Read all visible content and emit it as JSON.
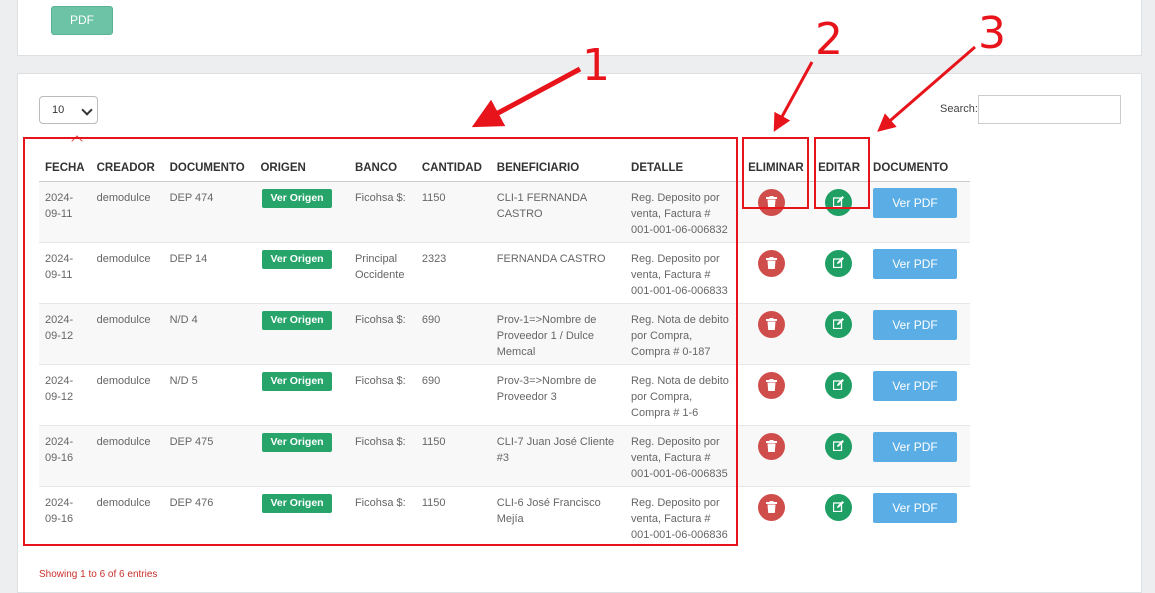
{
  "top_panel": {
    "pdf_label": "PDF"
  },
  "table_controls": {
    "page_length": "10",
    "search_label": "Search:",
    "search_value": ""
  },
  "columns": [
    "FECHA",
    "CREADOR",
    "DOCUMENTO",
    "ORIGEN",
    "BANCO",
    "CANTIDAD",
    "BENEFICIARIO",
    "DETALLE",
    "ELIMINAR",
    "EDITAR",
    "DOCUMENTO"
  ],
  "action_labels": {
    "ver_origen": "Ver Origen",
    "ver_pdf": "Ver PDF"
  },
  "rows": [
    {
      "fecha": [
        "2024-",
        "09-11"
      ],
      "creador": "demodulce",
      "documento": "DEP 474",
      "banco": [
        "Ficohsa $:"
      ],
      "cantidad": "1150",
      "beneficiario": [
        "CLI-1   FERNANDA",
        "CASTRO"
      ],
      "detalle": [
        "Reg. Deposito por",
        "venta, Factura #",
        "001-001-06-006832"
      ]
    },
    {
      "fecha": [
        "2024-",
        "09-11"
      ],
      "creador": "demodulce",
      "documento": "DEP 14",
      "banco": [
        "Principal",
        "Occidente"
      ],
      "cantidad": "2323",
      "beneficiario": [
        "FERNANDA CASTRO"
      ],
      "detalle": [
        "Reg. Deposito por",
        "venta, Factura #",
        "001-001-06-006833"
      ]
    },
    {
      "fecha": [
        "2024-",
        "09-12"
      ],
      "creador": "demodulce",
      "documento": "N/D 4",
      "banco": [
        "Ficohsa $:"
      ],
      "cantidad": "690",
      "beneficiario": [
        "Prov-1=>Nombre de",
        "Proveedor 1 / Dulce",
        "Memcal"
      ],
      "detalle": [
        "Reg. Nota de debito",
        "por Compra,",
        "Compra # 0-187"
      ]
    },
    {
      "fecha": [
        "2024-",
        "09-12"
      ],
      "creador": "demodulce",
      "documento": "N/D 5",
      "banco": [
        "Ficohsa $:"
      ],
      "cantidad": "690",
      "beneficiario": [
        "Prov-3=>Nombre de",
        "Proveedor 3"
      ],
      "detalle": [
        "Reg. Nota de debito",
        "por Compra,",
        "Compra # 1-6"
      ]
    },
    {
      "fecha": [
        "2024-",
        "09-16"
      ],
      "creador": "demodulce",
      "documento": "DEP 475",
      "banco": [
        "Ficohsa $:"
      ],
      "cantidad": "1150",
      "beneficiario": [
        "CLI-7   Juan José Cliente",
        "#3"
      ],
      "detalle": [
        "Reg. Deposito por",
        "venta, Factura #",
        "001-001-06-006835"
      ]
    },
    {
      "fecha": [
        "2024-",
        "09-16"
      ],
      "creador": "demodulce",
      "documento": "DEP 476",
      "banco": [
        "Ficohsa $:"
      ],
      "cantidad": "1150",
      "beneficiario": [
        "CLI-6   José Francisco",
        "Mejía"
      ],
      "detalle": [
        "Reg. Deposito por",
        "venta, Factura #",
        "001-001-06-006836"
      ]
    }
  ],
  "footer": {
    "info": "Showing 1 to 6 of 6 entries"
  },
  "annotations": [
    "1",
    "2",
    "3"
  ],
  "colors": {
    "annotation": "#e8141b",
    "delete": "#cf4e4c",
    "edit": "#1f9f63",
    "origin": "#26a46a",
    "pdf_button": "#5baee5",
    "top_pdf": "#6cc3a5"
  }
}
